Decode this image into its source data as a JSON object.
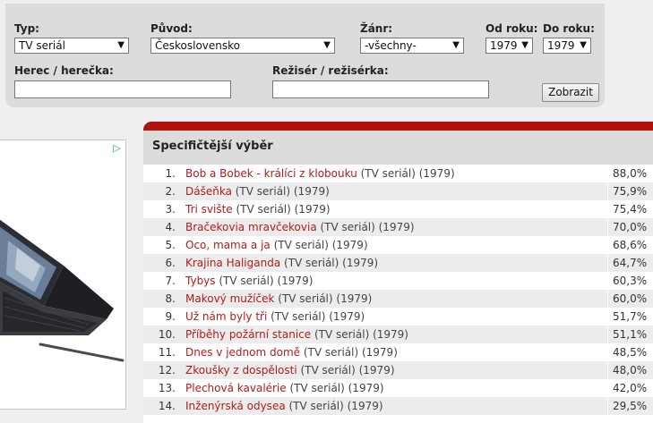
{
  "filters": {
    "type": {
      "label": "Typ:",
      "value": "TV seriál"
    },
    "origin": {
      "label": "Původ:",
      "value": "Československo"
    },
    "genre": {
      "label": "Žánr:",
      "value": "-všechny-"
    },
    "from_year": {
      "label": "Od roku:",
      "value": "1979"
    },
    "to_year": {
      "label": "Do roku:",
      "value": "1979"
    },
    "actor": {
      "label": "Herec / herečka:",
      "value": ""
    },
    "director": {
      "label": "Režisér / režisérka:",
      "value": ""
    },
    "submit_label": "Zobrazit"
  },
  "ad": {
    "badge": "▷"
  },
  "results": {
    "title": "Specifičtější výběr",
    "items": [
      {
        "rank": "1.",
        "title": "Bob a Bobek - králíci z klobouku",
        "meta": " (TV seriál) (1979)",
        "rating": "88,0%"
      },
      {
        "rank": "2.",
        "title": "Dášeňka",
        "meta": " (TV seriál) (1979)",
        "rating": "75,9%"
      },
      {
        "rank": "3.",
        "title": "Tri svište",
        "meta": " (TV seriál) (1979)",
        "rating": "75,4%"
      },
      {
        "rank": "4.",
        "title": "Bračekovia mravčekovia",
        "meta": " (TV seriál) (1979)",
        "rating": "70,0%"
      },
      {
        "rank": "5.",
        "title": "Oco, mama a ja",
        "meta": " (TV seriál) (1979)",
        "rating": "68,6%"
      },
      {
        "rank": "6.",
        "title": "Krajina Haliganda",
        "meta": " (TV seriál) (1979)",
        "rating": "64,7%"
      },
      {
        "rank": "7.",
        "title": "Tybys",
        "meta": " (TV seriál) (1979)",
        "rating": "60,3%"
      },
      {
        "rank": "8.",
        "title": "Makový mužíček",
        "meta": " (TV seriál) (1979)",
        "rating": "60,0%"
      },
      {
        "rank": "9.",
        "title": "Už nám byly tři",
        "meta": " (TV seriál) (1979)",
        "rating": "51,7%"
      },
      {
        "rank": "10.",
        "title": "Příběhy požární stanice",
        "meta": " (TV seriál) (1979)",
        "rating": "51,1%"
      },
      {
        "rank": "11.",
        "title": "Dnes v jednom domě",
        "meta": " (TV seriál) (1979)",
        "rating": "48,5%"
      },
      {
        "rank": "12.",
        "title": "Zkoušky z dospělosti",
        "meta": " (TV seriál) (1979)",
        "rating": "48,0%"
      },
      {
        "rank": "13.",
        "title": "Plechová kavalérie",
        "meta": " (TV seriál) (1979)",
        "rating": "42,0%"
      },
      {
        "rank": "14.",
        "title": "Inženýrská odysea",
        "meta": " (TV seriál) (1979)",
        "rating": "29,5%"
      }
    ]
  }
}
